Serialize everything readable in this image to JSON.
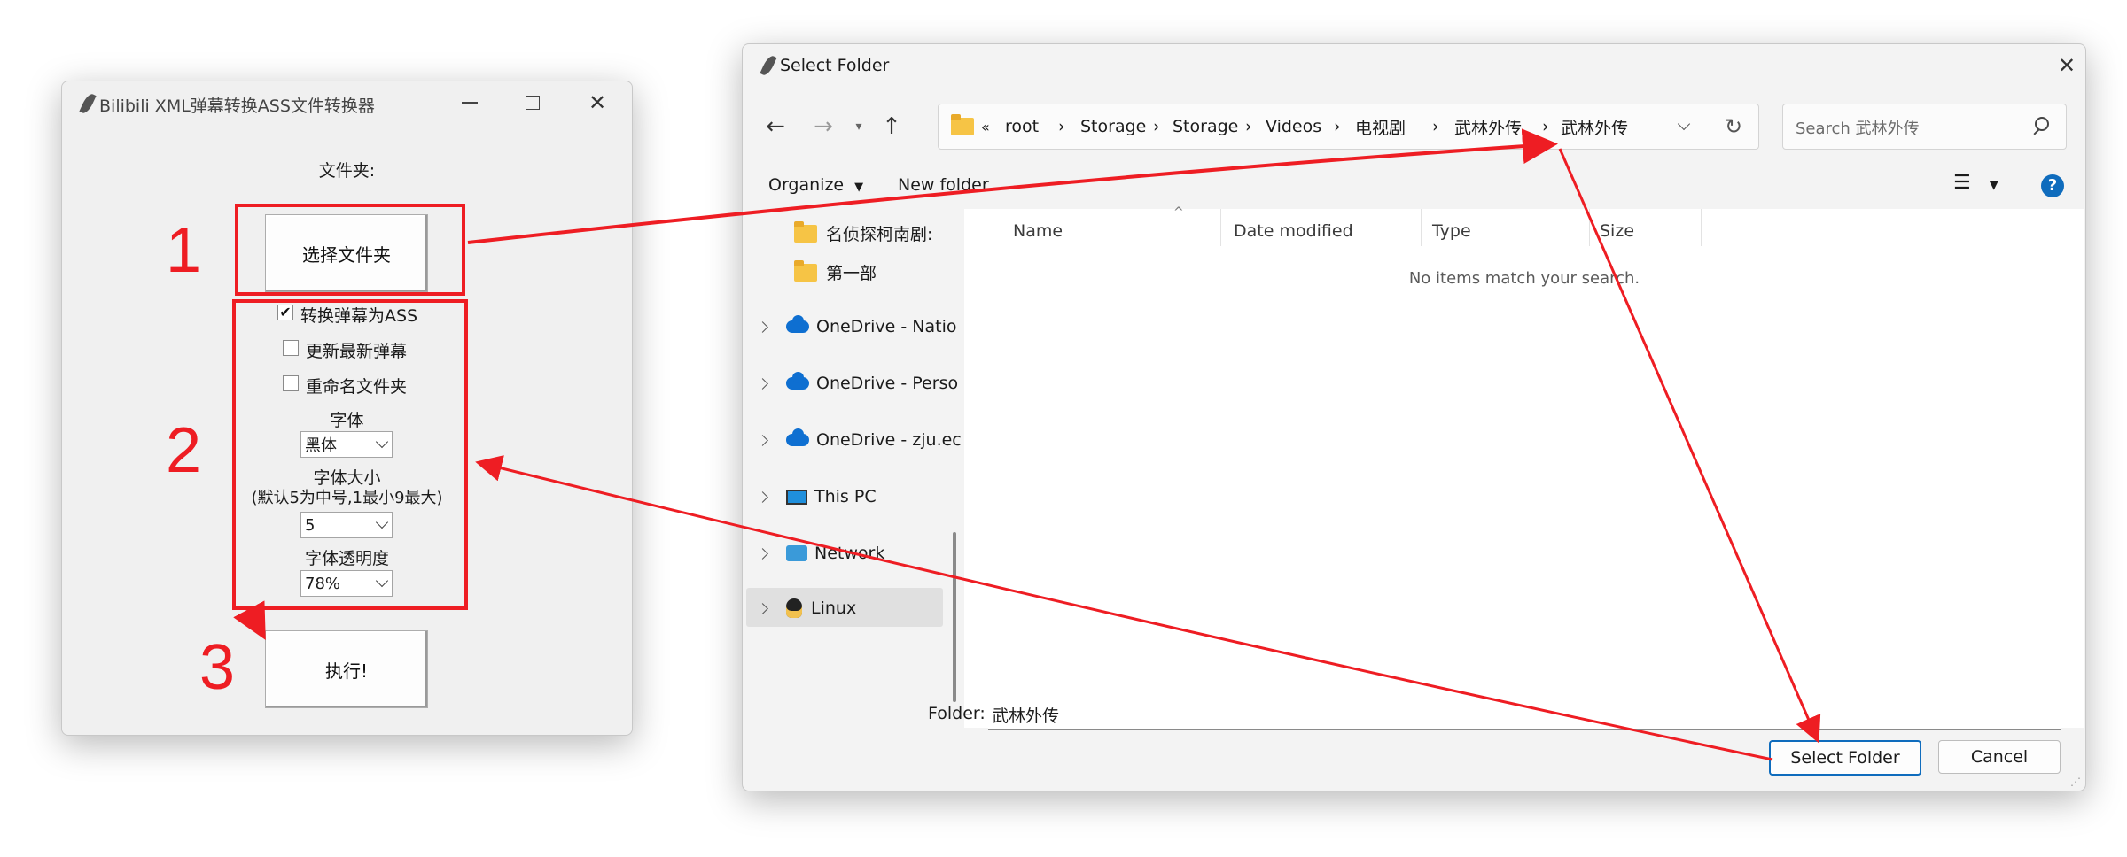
{
  "converter": {
    "title": "Bilibili XML弹幕转换ASS文件转换器",
    "folder_label": "文件夹:",
    "select_folder_button": "选择文件夹",
    "options": [
      {
        "label": "转换弹幕为ASS",
        "checked": true,
        "mark": "✔"
      },
      {
        "label": "更新最新弹幕",
        "checked": false,
        "mark": ""
      },
      {
        "label": "重命名文件夹",
        "checked": false,
        "mark": ""
      }
    ],
    "font_label": "字体",
    "font_value": "黑体",
    "size_label": "字体大小",
    "size_hint": "(默认5为中号,1最小9最大)",
    "size_value": "5",
    "opacity_label": "字体透明度",
    "opacity_value": "78%",
    "run_button": "执行!"
  },
  "annotations": {
    "step1": "1",
    "step2": "2",
    "step3": "3",
    "color": "#ee1d23"
  },
  "dialog": {
    "title": "Select Folder",
    "breadcrumb_prefix": "«",
    "breadcrumb": [
      "root",
      "Storage",
      "Storage",
      "Videos",
      "电视剧",
      "武林外传",
      "武林外传"
    ],
    "search_placeholder": "Search 武林外传",
    "toolbar": {
      "organize": "Organize",
      "new_folder": "New folder"
    },
    "nav": [
      {
        "label": "名侦探柯南剧:",
        "icon": "folder-icon"
      },
      {
        "label": "第一部",
        "icon": "folder-icon"
      },
      {
        "label": "OneDrive - Natio",
        "icon": "onedrive-icon"
      },
      {
        "label": "OneDrive - Perso",
        "icon": "onedrive-icon"
      },
      {
        "label": "OneDrive - zju.ec",
        "icon": "onedrive-icon"
      },
      {
        "label": "This PC",
        "icon": "monitor-icon"
      },
      {
        "label": "Network",
        "icon": "network-icon"
      },
      {
        "label": "Linux",
        "icon": "linux-penguin-icon"
      }
    ],
    "columns": [
      "Name",
      "Date modified",
      "Type",
      "Size"
    ],
    "empty_message": "No items match your search.",
    "folder_label": "Folder:",
    "folder_value": "武林外传",
    "select_button": "Select Folder",
    "cancel_button": "Cancel",
    "accent": "#0f6cbd"
  }
}
